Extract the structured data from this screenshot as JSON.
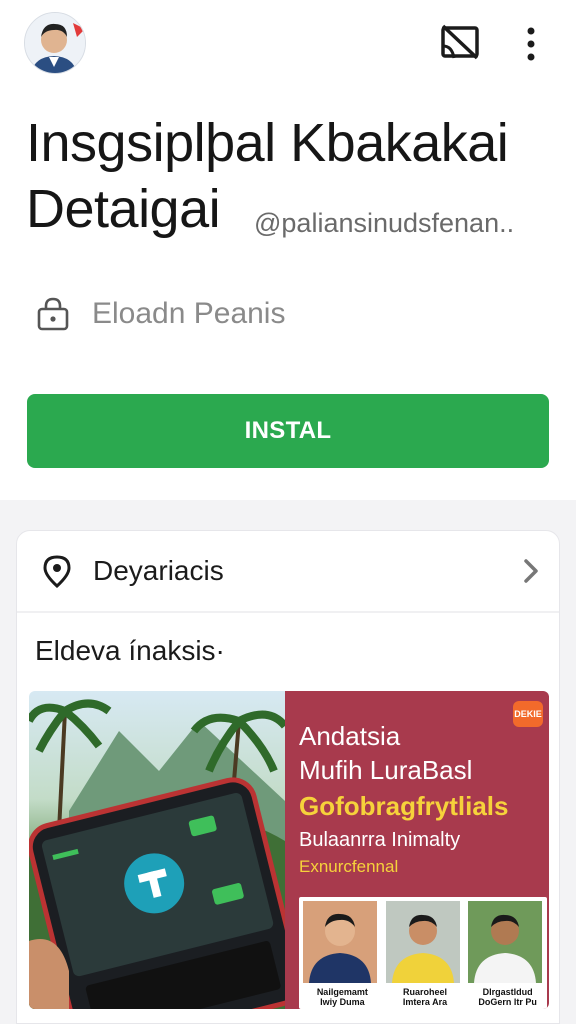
{
  "app": {
    "title_line1": "Insgsiplþal Kbakakai",
    "title_line2": "Detaigai",
    "handle": "@paliansinudsfenan..",
    "lock_label": "Eloadn Peanis",
    "install_label": "INSTAL"
  },
  "card": {
    "header_label": "Deyariacis",
    "section_title": "Eldeva ínaksis·"
  },
  "banner": {
    "badge": "DEKIE",
    "line1": "Andatsia",
    "line2": "Mufih LuraBasl",
    "line3": "Gofobragfrytlials",
    "line4": "Bulaanrra Inimalty",
    "line5": "Exnurcfennal",
    "people": [
      {
        "caption": "Nailgemamt\nIwiy Duma"
      },
      {
        "caption": "Ruaroheel\nImtera Ara"
      },
      {
        "caption": "Dlrgastldud\nDoGern ltr Pu"
      }
    ]
  },
  "icons": [
    "avatar",
    "cast-off-icon",
    "more-vert-icon",
    "lock-icon",
    "location-pin-icon",
    "chevron-right-icon"
  ],
  "colors": {
    "accent": "#2ba94f",
    "promo_bg": "#a83a4d",
    "promo_highlight": "#f6d23b"
  }
}
